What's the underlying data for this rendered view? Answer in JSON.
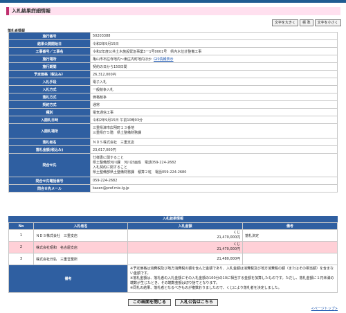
{
  "page": {
    "title": "入札結果詳細情報"
  },
  "font_buttons": [
    "文字を大きく",
    "標 準",
    "文字を小さく"
  ],
  "section_label": "落札者情報",
  "rows": [
    {
      "label": "施行番号",
      "value": "50203388"
    },
    {
      "label": "結果公開開始日",
      "value": "令和2年9月15日"
    },
    {
      "label": "工事番号／工事名",
      "value": "令和2年度公共土木施設緊急事業3ー1号0001号　県内水位計整備工事"
    },
    {
      "label": "施行場所",
      "value": "亀山市石往寺地内～東庄内町地内ほか",
      "link": "GIS情報表示"
    },
    {
      "label": "施行期間",
      "value": "契約の日から150日間"
    },
    {
      "label": "予定価格（税込み）",
      "value": "26,312,000円"
    },
    {
      "label": "入札手段",
      "value": "電子入札"
    },
    {
      "label": "入札方式",
      "value": "一般競争入札"
    },
    {
      "label": "落札方式",
      "value": "価格競争"
    },
    {
      "label": "契約方式",
      "value": "通常"
    },
    {
      "label": "種別",
      "value": "電気通信工事"
    },
    {
      "label": "入開札日時",
      "value": "令和2年9月15日 午前10時03分"
    },
    {
      "label": "入開札場所",
      "value": "三重県津市広明町１３番地\n三重県庁５階　県土整備財務課"
    },
    {
      "label": "落札者名",
      "value": "ＮＤＳ株式会社　三重支店"
    },
    {
      "label": "落札金額(税込み)",
      "value": "23,617,000円"
    },
    {
      "label": "問合せ先",
      "value": "仕様書に関すること\n県土整備部河川課　河川計画班　電話059-224-2682\n入札契約に関すること\n県土整備部県土整備財務課　積算２班　電話059-224-2680"
    },
    {
      "label": "問合せ先電話番号",
      "value": "059-224-2682"
    },
    {
      "label": "問合せ先メール",
      "value": "kasen@pref.mie.lg.jp"
    }
  ],
  "results": {
    "title": "入札結果情報",
    "headers": [
      "No",
      "入札者名",
      "入札金額",
      "備考"
    ],
    "rows": [
      {
        "no": "1",
        "name": "ＮＤＳ株式会社　三重支店",
        "mark": "くじ",
        "amount": "21,470,000円",
        "note": "落札決定"
      },
      {
        "no": "2",
        "name": "株式会社昭和　名古屋支店",
        "mark": "くじ",
        "amount": "21,470,000円",
        "note": ""
      },
      {
        "no": "3",
        "name": "株式会社日弘　三重営業所",
        "mark": "",
        "amount": "21,480,000円",
        "note": ""
      }
    ],
    "biko_label": "備考",
    "biko_text": "※予定価格は消費税及び地方消費税の額を含んだ金額であり、入札金額は消費税及び地方消費税の額（またはその相当額）を含まない金額です。\n※落札金額は、落札者の入札金額にその入札金額の100分の10に相当する金額を加算したものです。ただし、落札金額に１円未満の端数が生じたとき、その端数金額は切り捨てとなります。\n※同札の結果、落札者となるべきものが複数おりましたので、くじにより落札者を決定しました。"
  },
  "bottom": {
    "close": "この画面を閉じる",
    "notice": "入札公告はこちら",
    "pagetop": "ページトップ"
  }
}
